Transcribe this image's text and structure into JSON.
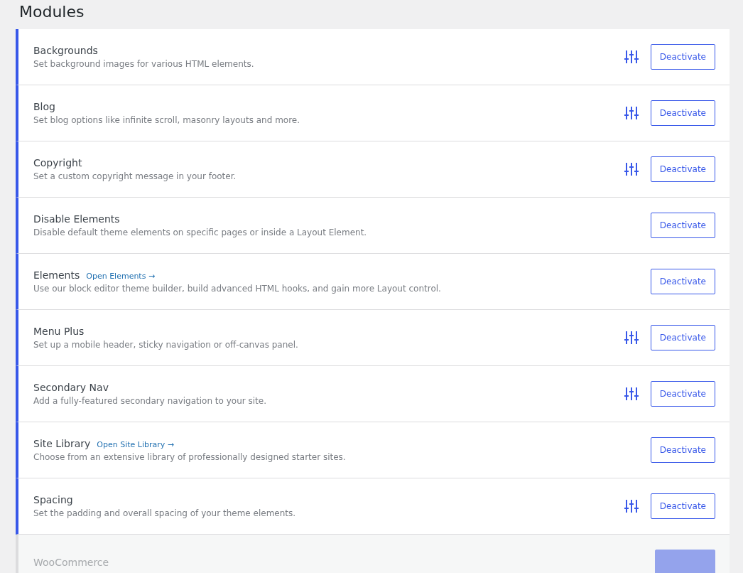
{
  "title": "Modules",
  "modules": [
    {
      "name": "Backgrounds",
      "description": "Set background images for various HTML elements.",
      "active": true,
      "has_settings": true,
      "button": "Deactivate"
    },
    {
      "name": "Blog",
      "description": "Set blog options like infinite scroll, masonry layouts and more.",
      "active": true,
      "has_settings": true,
      "button": "Deactivate"
    },
    {
      "name": "Copyright",
      "description": "Set a custom copyright message in your footer.",
      "active": true,
      "has_settings": true,
      "button": "Deactivate"
    },
    {
      "name": "Disable Elements",
      "description": "Disable default theme elements on specific pages or inside a Layout Element.",
      "active": true,
      "has_settings": false,
      "button": "Deactivate"
    },
    {
      "name": "Elements",
      "link": "Open Elements →",
      "description": "Use our block editor theme builder, build advanced HTML hooks, and gain more Layout control.",
      "active": true,
      "has_settings": false,
      "button": "Deactivate"
    },
    {
      "name": "Menu Plus",
      "description": "Set up a mobile header, sticky navigation or off-canvas panel.",
      "active": true,
      "has_settings": true,
      "button": "Deactivate"
    },
    {
      "name": "Secondary Nav",
      "description": "Add a fully-featured secondary navigation to your site.",
      "active": true,
      "has_settings": true,
      "button": "Deactivate"
    },
    {
      "name": "Site Library",
      "link": "Open Site Library →",
      "description": "Choose from an extensive library of professionally designed starter sites.",
      "active": true,
      "has_settings": false,
      "button": "Deactivate"
    },
    {
      "name": "Spacing",
      "description": "Set the padding and overall spacing of your theme elements.",
      "active": true,
      "has_settings": true,
      "button": "Deactivate"
    },
    {
      "name": "WooCommerce",
      "active": false,
      "has_settings": false
    }
  ]
}
